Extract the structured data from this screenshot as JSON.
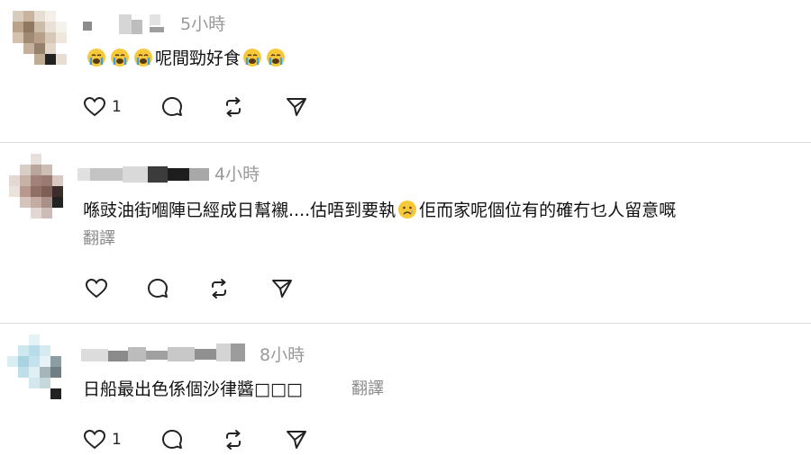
{
  "comments": [
    {
      "time": "5小時",
      "text_parts": [
        "",
        "",
        "",
        "呢間勁好食",
        "",
        ""
      ],
      "emoji": [
        "crying-face",
        "crying-face",
        "crying-face",
        "crying-face",
        "crying-face"
      ],
      "like_count": "1"
    },
    {
      "time": "4小時",
      "text_before": "喺豉油街嗰陣已經成日幫襯....估唔到要執",
      "emoji": "sad-face",
      "text_after": "佢而家呢個位有的確冇乜人留意嘅",
      "translate": "翻譯"
    },
    {
      "time": "8小時",
      "text": "日船最出色係個沙律醬□□□",
      "translate": "翻譯",
      "like_count": "1"
    }
  ],
  "icons": {
    "like": "heart-icon",
    "reply": "comment-icon",
    "repost": "repost-icon",
    "share": "send-icon"
  },
  "colors": {
    "emoji_face": "#f7c93a",
    "emoji_tear": "#3aa0e8",
    "muted": "#9a9a9a",
    "divider": "#dcdcdc"
  }
}
